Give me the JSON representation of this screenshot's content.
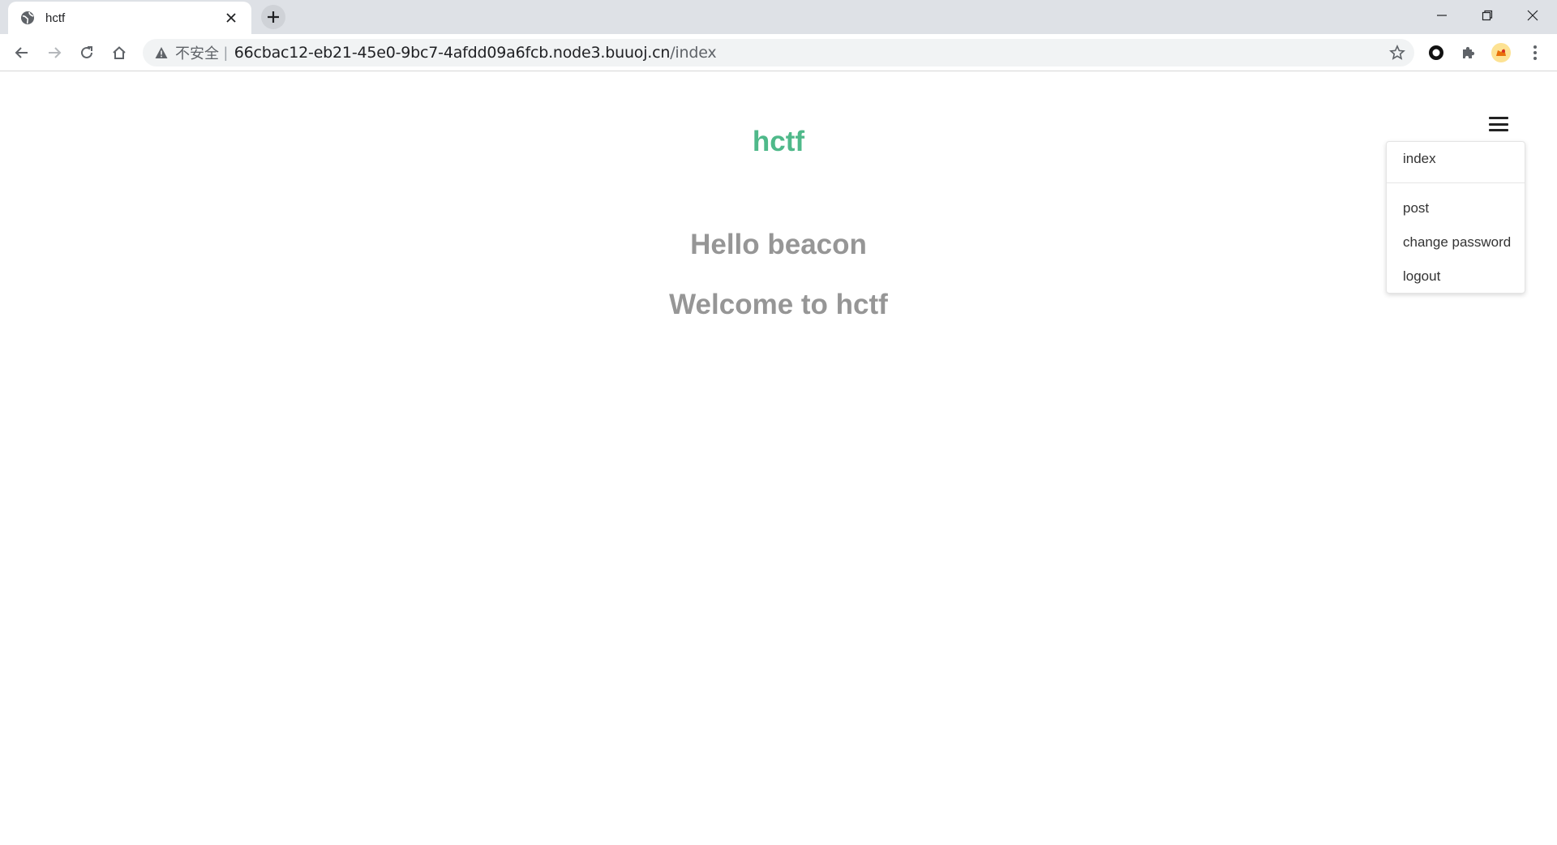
{
  "browser": {
    "tab_title": "hctf",
    "insecure_label": "不安全",
    "separator": "|",
    "url_host": "66cbac12-eb21-45e0-9bc7-4afdd09a6fcb.node3.buuoj.cn",
    "url_path": "/index"
  },
  "site": {
    "brand": "hctf",
    "greeting": "Hello beacon",
    "welcome": "Welcome to hctf"
  },
  "menu": {
    "items": [
      {
        "label": "index"
      },
      {
        "label": "post"
      },
      {
        "label": "change password"
      },
      {
        "label": "logout"
      }
    ]
  },
  "colors": {
    "brand": "#4fb98a",
    "heading": "#969696"
  }
}
